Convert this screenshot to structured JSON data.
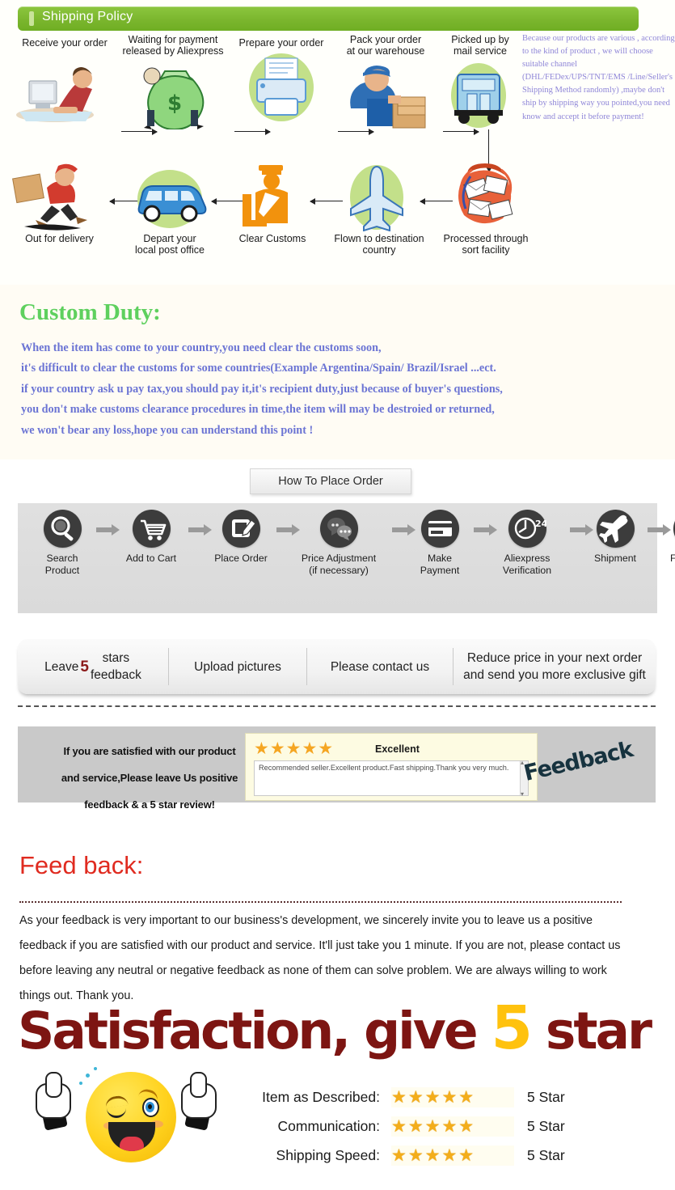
{
  "shipping": {
    "header_title": "Shipping Policy",
    "row1": [
      {
        "label": "Receive your order",
        "icon": "person-at-computer-icon"
      },
      {
        "label": "Waiting for payment\nreleased by Aliexpress",
        "icon": "money-bag-icon"
      },
      {
        "label": "Prepare your order",
        "icon": "printer-icon"
      },
      {
        "label": "Pack your order\nat our warehouse",
        "icon": "worker-packing-icon"
      },
      {
        "label": "Picked up by\nmail service",
        "icon": "mail-truck-icon"
      }
    ],
    "row2": [
      {
        "label": "Out for delivery",
        "icon": "delivery-man-running-icon"
      },
      {
        "label": "Depart your\nlocal post office",
        "icon": "post-van-icon"
      },
      {
        "label": "Clear Customs",
        "icon": "customs-officer-icon"
      },
      {
        "label": "Flown to destination\ncountry",
        "icon": "airplane-icon"
      },
      {
        "label": "Processed through\nsort facility",
        "icon": "mail-sorting-icon"
      }
    ],
    "note": "Because our products are various , according to the kind of product , we will choose suitable channel (DHL/FEDex/UPS/TNT/EMS /Line/Seller's Shipping Method randomly) ,maybe don't ship by shipping way you pointed,you need know and accept it before payment!"
  },
  "custom_duty": {
    "title": "Custom Duty:",
    "lines": [
      "When the item has come to your country,you need clear the customs soon,",
      "it's difficult to clear the customs for some countries(Example Argentina/Spain/ Brazil/Israel ...ect.",
      "if your country ask u pay tax,you should pay it,it's recipient duty,just because of buyer's questions,",
      "you don't make customs clearance procedures in time,the item will may be destroied or returned,",
      "we won't bear any loss,hope you can understand this point !"
    ]
  },
  "how_to_order": {
    "button_label": "How To Place Order",
    "steps": [
      {
        "label": "Search\nProduct",
        "icon": "magnifier-icon"
      },
      {
        "label": "Add  to  Cart",
        "icon": "shopping-cart-icon"
      },
      {
        "label": "Place Order",
        "icon": "edit-note-icon"
      },
      {
        "label": "Price  Adjustment\n(if necessary)",
        "icon": "chat-bubbles-icon"
      },
      {
        "label": "Make\nPayment",
        "icon": "credit-card-icon"
      },
      {
        "label": "Aliexpress\nVerification",
        "icon": "clock-24-icon"
      },
      {
        "label": "Shipment",
        "icon": "airplane-icon"
      },
      {
        "label": "Feedback",
        "icon": "thumbs-up-icon"
      }
    ]
  },
  "strip": {
    "cells": [
      {
        "pre": "Leave ",
        "accent": "5",
        "post": " stars\nfeedback"
      },
      {
        "pre": "Upload pictures",
        "accent": "",
        "post": ""
      },
      {
        "pre": "Please contact us",
        "accent": "",
        "post": ""
      },
      {
        "pre": "Reduce  price in your next order\nand send you more exclusive gift",
        "accent": "",
        "post": ""
      }
    ]
  },
  "grey_band": {
    "left_text": "If you are satisfied with our product\nand service,Please leave Us positive\nfeedback & a 5 star review!",
    "card": {
      "stars": "★★★★★",
      "rating_label": "Excellent",
      "review_text": "Recommended seller.Excellent product.Fast shipping.Thank you very much."
    },
    "watermark": "Feedback"
  },
  "feedback": {
    "title": "Feed back:",
    "paragraph": "As your feedback is very important to our business's development, we sincerely invite you to leave us a positive feedback if you are satisfied with our product and service. It'll just take you 1 minute. If you are not, please contact us before leaving any neutral or negative feedback as none of them can solve problem. We are always willing to work things out.  Thank you."
  },
  "satisfaction": {
    "part1": "Satisfaction, give ",
    "five": "5",
    "part2": " star"
  },
  "ratings": {
    "rows": [
      {
        "label": "Item as Described:",
        "stars": "★★★★★",
        "value": "5 Star"
      },
      {
        "label": "Communication:",
        "stars": "★★★★★",
        "value": "5 Star"
      },
      {
        "label": "Shipping Speed:",
        "stars": "★★★★★",
        "value": "5 Star"
      }
    ]
  },
  "colors": {
    "header_green": "#7bb62e",
    "duty_title_green": "#5ed05e",
    "duty_body_purple": "#6b74d4",
    "note_purple": "#8f86d8",
    "feedback_red": "#e02b20",
    "satisfaction_dark_red": "#7d1512",
    "star_gold": "#f3ad1b",
    "band_grey": "#c9c9c9"
  }
}
